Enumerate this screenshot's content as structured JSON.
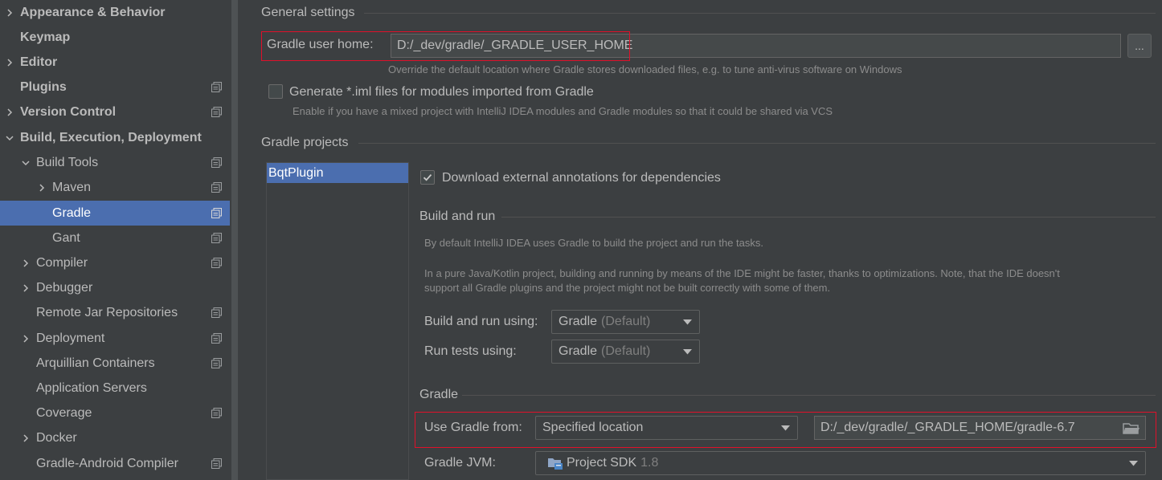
{
  "sidebar": {
    "items": [
      {
        "label": "Appearance & Behavior",
        "bold": true,
        "expandable": true,
        "expanded": false
      },
      {
        "label": "Keymap",
        "bold": true,
        "expandable": false
      },
      {
        "label": "Editor",
        "bold": true,
        "expandable": true,
        "expanded": false
      },
      {
        "label": "Plugins",
        "bold": true,
        "expandable": false,
        "project_icon": true
      },
      {
        "label": "Version Control",
        "bold": true,
        "expandable": true,
        "expanded": false,
        "project_icon": true
      },
      {
        "label": "Build, Execution, Deployment",
        "bold": true,
        "expandable": true,
        "expanded": true
      },
      {
        "label": "Build Tools",
        "bold": false,
        "expandable": true,
        "expanded": true,
        "project_icon": true
      },
      {
        "label": "Maven",
        "bold": false,
        "expandable": true,
        "expanded": false,
        "project_icon": true
      },
      {
        "label": "Gradle",
        "bold": false,
        "expandable": false,
        "selected": true,
        "project_icon": true
      },
      {
        "label": "Gant",
        "bold": false,
        "expandable": false,
        "project_icon": true
      },
      {
        "label": "Compiler",
        "bold": false,
        "expandable": true,
        "expanded": false,
        "project_icon": true
      },
      {
        "label": "Debugger",
        "bold": false,
        "expandable": true,
        "expanded": false
      },
      {
        "label": "Remote Jar Repositories",
        "bold": false,
        "expandable": false,
        "project_icon": true
      },
      {
        "label": "Deployment",
        "bold": false,
        "expandable": true,
        "expanded": false,
        "project_icon": true
      },
      {
        "label": "Arquillian Containers",
        "bold": false,
        "expandable": false,
        "project_icon": true
      },
      {
        "label": "Application Servers",
        "bold": false,
        "expandable": false
      },
      {
        "label": "Coverage",
        "bold": false,
        "expandable": false,
        "project_icon": true
      },
      {
        "label": "Docker",
        "bold": false,
        "expandable": true,
        "expanded": false
      },
      {
        "label": "Gradle-Android Compiler",
        "bold": false,
        "expandable": false,
        "project_icon": true
      }
    ]
  },
  "general": {
    "title": "General settings",
    "gradle_user_home_label": "Gradle user home:",
    "gradle_user_home_value": "D:/_dev/gradle/_GRADLE_USER_HOME",
    "browse_label": "...",
    "gradle_user_home_hint": "Override the default location where Gradle stores downloaded files, e.g. to tune anti-virus software on Windows",
    "generate_iml_label": "Generate *.iml files for modules imported from Gradle",
    "generate_iml_checked": false,
    "generate_iml_hint": "Enable if you have a mixed project with IntelliJ IDEA modules and Gradle modules so that it could be shared via VCS"
  },
  "projects": {
    "title": "Gradle projects",
    "list": [
      "BqtPlugin"
    ],
    "download_annotations_label": "Download external annotations for dependencies",
    "download_annotations_checked": true,
    "build_and_run": {
      "title": "Build and run",
      "hint1": "By default IntelliJ IDEA uses Gradle to build the project and run the tasks.",
      "hint2_line1": "In a pure Java/Kotlin project, building and running by means of the IDE might be faster, thanks to optimizations. Note, that the IDE doesn't",
      "hint2_line2": "support all Gradle plugins and the project might not be built correctly with some of them.",
      "build_using_label": "Build and run using:",
      "build_using_value": "Gradle",
      "build_using_suffix": "(Default)",
      "tests_using_label": "Run tests using:",
      "tests_using_value": "Gradle",
      "tests_using_suffix": "(Default)"
    },
    "gradle": {
      "title": "Gradle",
      "use_from_label": "Use Gradle from:",
      "use_from_value": "Specified location",
      "location_value": "D:/_dev/gradle/_GRADLE_HOME/gradle-6.7",
      "jvm_label": "Gradle JVM:",
      "jvm_value": "Project SDK",
      "jvm_version": "1.8"
    }
  },
  "colors": {
    "background": "#3c3f41",
    "selection": "#4b6eaf",
    "highlight_box": "#e0102a"
  }
}
